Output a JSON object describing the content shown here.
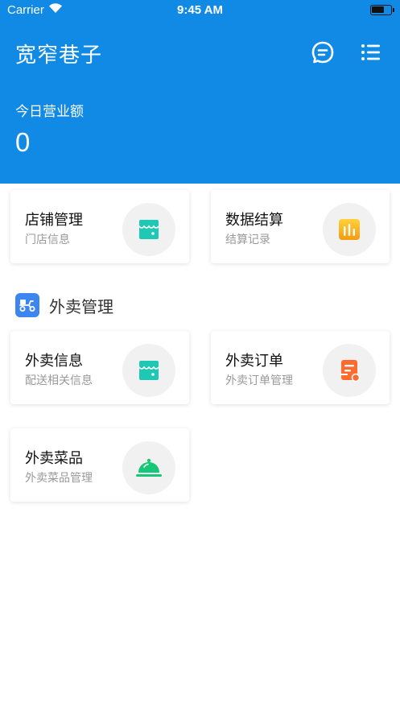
{
  "status_bar": {
    "carrier": "Carrier",
    "time": "9:45 AM"
  },
  "header": {
    "title": "宽窄巷子",
    "revenue_label": "今日营业额",
    "revenue_value": "0",
    "message_icon": "chat-bubble-icon",
    "menu_icon": "list-icon"
  },
  "top_cards": [
    {
      "title": "店铺管理",
      "subtitle": "门店信息",
      "icon": "store-icon",
      "icon_color": "#1ec8b4"
    },
    {
      "title": "数据结算",
      "subtitle": "结算记录",
      "icon": "bar-chart-icon",
      "icon_color": "#f7b51e"
    }
  ],
  "section": {
    "title": "外卖管理",
    "icon": "scooter-icon",
    "icon_color": "#3d86f0"
  },
  "delivery_cards": [
    {
      "title": "外卖信息",
      "subtitle": "配送相关信息",
      "icon": "store-icon",
      "icon_color": "#1ec8b4"
    },
    {
      "title": "外卖订单",
      "subtitle": "外卖订单管理",
      "icon": "order-receipt-icon",
      "icon_color": "#ff6a2e"
    },
    {
      "title": "外卖菜品",
      "subtitle": "外卖菜品管理",
      "icon": "food-cloche-icon",
      "icon_color": "#16c777"
    }
  ],
  "colors": {
    "header_bg": "#118ae6"
  }
}
